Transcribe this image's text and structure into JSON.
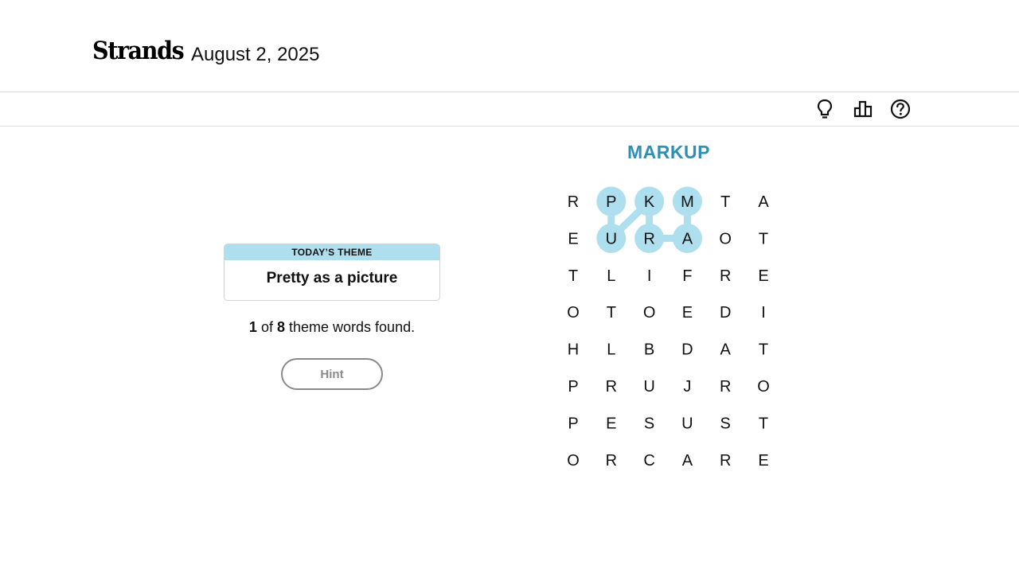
{
  "header": {
    "app_title": "Strands",
    "date": "August 2, 2025"
  },
  "toolbar": {
    "icons": [
      "lightbulb-icon",
      "stats-icon",
      "help-icon"
    ]
  },
  "theme_card": {
    "label": "TODAY’S THEME",
    "theme": "Pretty as a picture"
  },
  "progress": {
    "found": "1",
    "of_text": "of",
    "total": "8",
    "suffix": "theme words found."
  },
  "hint_button": {
    "label": "Hint"
  },
  "current_word": "MARKUP",
  "grid": {
    "rows": [
      [
        "R",
        "P",
        "K",
        "M",
        "T",
        "A"
      ],
      [
        "E",
        "U",
        "R",
        "A",
        "O",
        "T"
      ],
      [
        "T",
        "L",
        "I",
        "F",
        "R",
        "E"
      ],
      [
        "O",
        "T",
        "O",
        "E",
        "D",
        "I"
      ],
      [
        "H",
        "L",
        "B",
        "D",
        "A",
        "T"
      ],
      [
        "P",
        "R",
        "U",
        "J",
        "R",
        "O"
      ],
      [
        "P",
        "E",
        "S",
        "U",
        "S",
        "T"
      ],
      [
        "O",
        "R",
        "C",
        "A",
        "R",
        "E"
      ]
    ],
    "selected_path": [
      [
        0,
        3
      ],
      [
        1,
        3
      ],
      [
        1,
        2
      ],
      [
        0,
        2
      ],
      [
        1,
        1
      ],
      [
        0,
        1
      ]
    ],
    "highlight_color": "#aedfee"
  },
  "colors": {
    "accent": "#2e8fb4",
    "theme_band": "#aedfee",
    "hint_border": "#8a8a8a"
  }
}
